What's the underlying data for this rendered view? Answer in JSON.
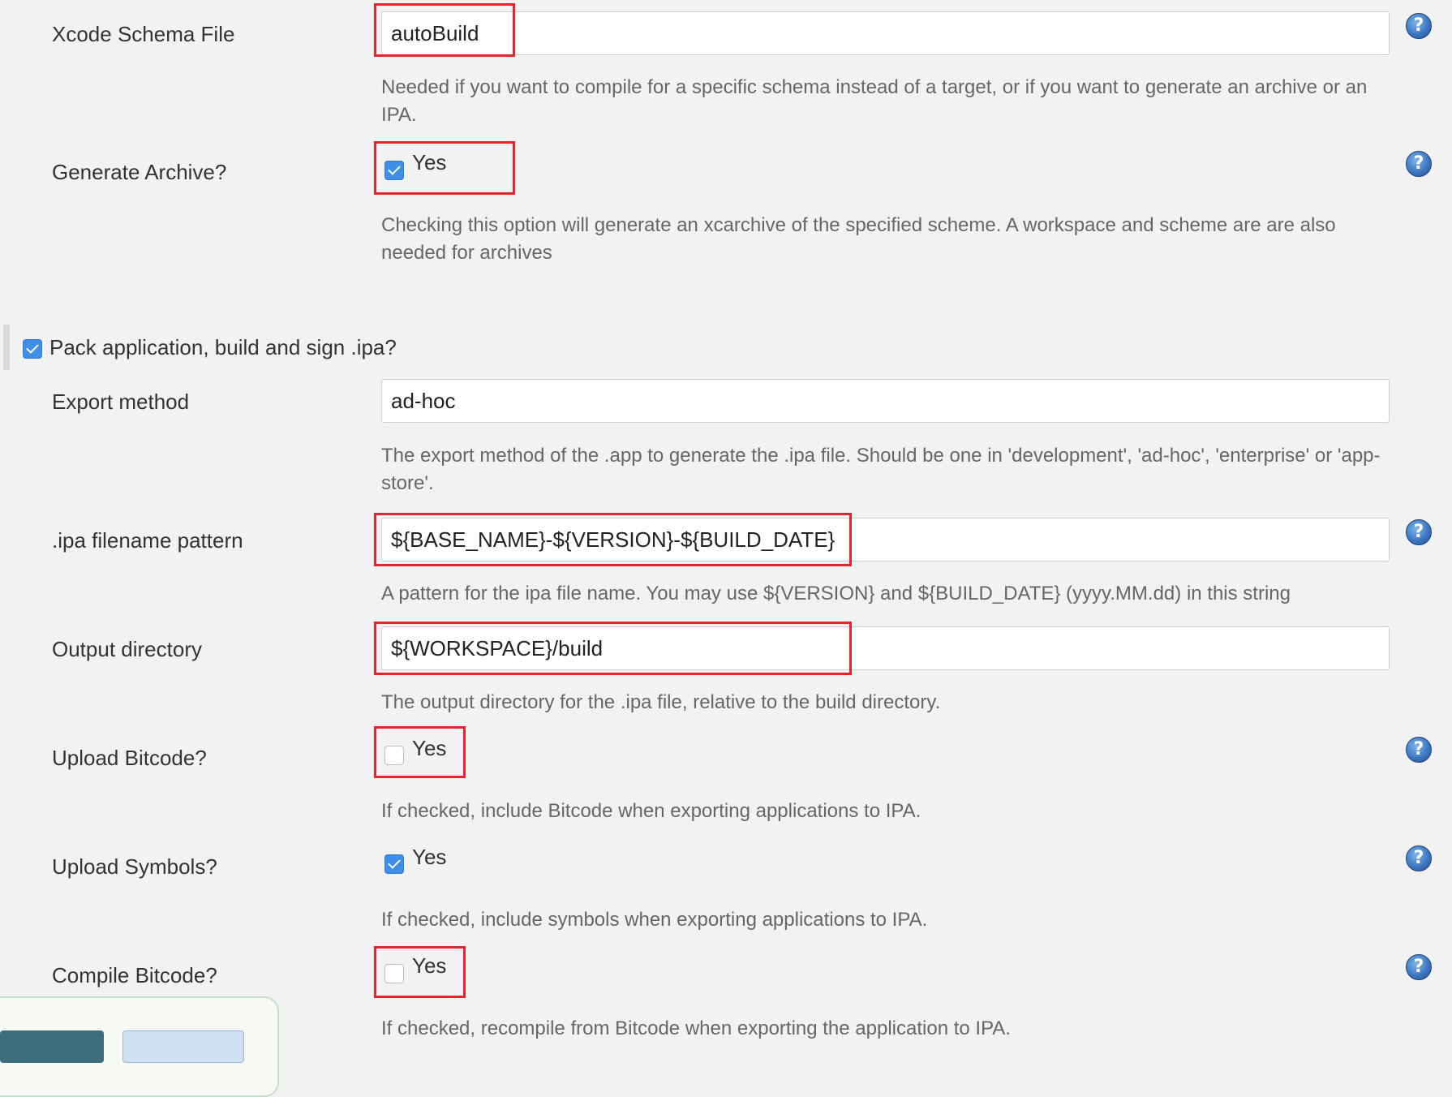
{
  "xcode_schema": {
    "label": "Xcode Schema File",
    "value": "autoBuild",
    "help": "Needed if you want to compile for a specific schema instead of a target, or if you want to generate an archive or an IPA."
  },
  "generate_archive": {
    "label": "Generate Archive?",
    "option": "Yes",
    "checked": true,
    "help": "Checking this option will generate an xcarchive of the specified scheme. A workspace and scheme are are also needed for archives"
  },
  "pack_section": {
    "label": "Pack application, build and sign .ipa?",
    "checked": true
  },
  "export_method": {
    "label": "Export method",
    "value": "ad-hoc",
    "help": "The export method of the .app to generate the .ipa file. Should be one in 'development', 'ad-hoc', 'enterprise' or 'app-store'."
  },
  "ipa_pattern": {
    "label": ".ipa filename pattern",
    "value": "${BASE_NAME}-${VERSION}-${BUILD_DATE}",
    "help": "A pattern for the ipa file name. You may use ${VERSION} and ${BUILD_DATE} (yyyy.MM.dd) in this string"
  },
  "output_directory": {
    "label": "Output directory",
    "value": "${WORKSPACE}/build",
    "help": "The output directory for the .ipa file, relative to the build directory."
  },
  "upload_bitcode": {
    "label": "Upload Bitcode?",
    "option": "Yes",
    "checked": false,
    "help": "If checked, include Bitcode when exporting applications to IPA."
  },
  "upload_symbols": {
    "label": "Upload Symbols?",
    "option": "Yes",
    "checked": true,
    "help": "If checked, include symbols when exporting applications to IPA."
  },
  "compile_bitcode": {
    "label": "Compile Bitcode?",
    "option": "Yes",
    "checked": false,
    "help": "If checked, recompile from Bitcode when exporting the application to IPA."
  },
  "colors": {
    "highlight": "#e5252b",
    "checkbox_on": "#3f8fe6",
    "help_icon": "#3d78c2"
  },
  "icons": {
    "help": "question-circle-icon",
    "check": "checkmark-icon"
  }
}
